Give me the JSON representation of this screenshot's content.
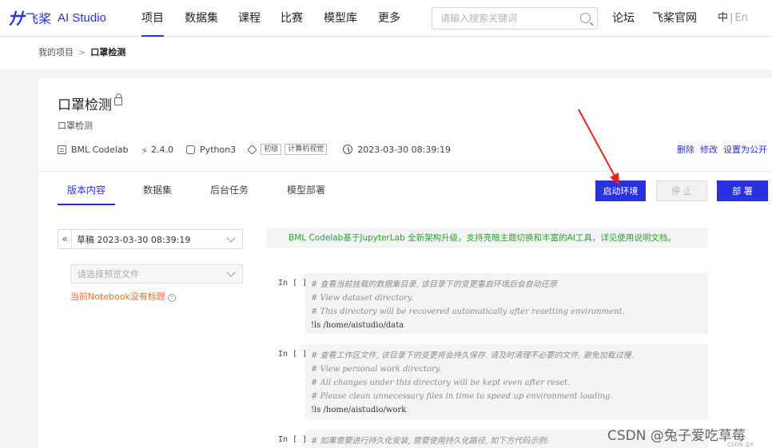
{
  "nav": {
    "logo_text": "飞桨",
    "logo_sub": "AI Studio",
    "items": [
      "项目",
      "数据集",
      "课程",
      "比赛",
      "模型库",
      "更多"
    ],
    "search_placeholder": "请输入搜索关键词",
    "right_links": [
      "论坛",
      "飞桨官网"
    ],
    "lang_zh": "中",
    "lang_en": "En"
  },
  "breadcrumb": {
    "root": "我的项目",
    "separator": ">",
    "current": "口罩检测"
  },
  "project": {
    "title": "口罩检测",
    "description": "口罩检测",
    "env": "BML Codelab",
    "version": "2.4.0",
    "language": "Python3",
    "tags": [
      "初级",
      "计算机视觉"
    ],
    "datetime": "2023-03-30 08:39:19",
    "actions": [
      "删除",
      "修改",
      "设置为公开"
    ]
  },
  "tabs": [
    "版本内容",
    "数据集",
    "后台任务",
    "模型部署"
  ],
  "buttons": {
    "start": "启动环境",
    "stop": "停 止",
    "deploy": "部 署"
  },
  "draft": {
    "collapse": "«",
    "value": "草稿 2023-03-30 08:39:19",
    "preview_placeholder": "请选择预览文件",
    "warning": "当前Notebook没有标题",
    "help": "?"
  },
  "notebook": {
    "banner": "BML Codelab基于JupyterLab 全新架构升级，支持亮暗主题切换和丰富的AI工具，详见使用说明文档。",
    "cells": [
      {
        "label": "In [ ]",
        "comments": [
          "# 查看当前挂载的数据集目录, 该目录下的变更重启环境后会自动还原",
          "# View dataset directory.",
          "# This directory will be recovered automatically after resetting environment."
        ],
        "code": "!ls /home/aistudio/data"
      },
      {
        "label": "In [ ]",
        "comments": [
          "# 查看工作区文件, 该目录下的变更将会持久保存. 请及时清理不必要的文件, 避免加载过慢.",
          "# View personal work directory.",
          "# All changes under this directory will be kept even after reset.",
          "# Please clean unnecessary files in time to speed up environment loading."
        ],
        "code": "!ls /home/aistudio/work"
      },
      {
        "label": "In [ ]",
        "comments": [
          "# 如果需要进行持久化安装, 需要使用持久化路径, 如下方代码示例:"
        ],
        "code": ""
      }
    ]
  },
  "watermark": "CSDN @兔子爱吃草莓",
  "watermark_small": "CSDN @F"
}
